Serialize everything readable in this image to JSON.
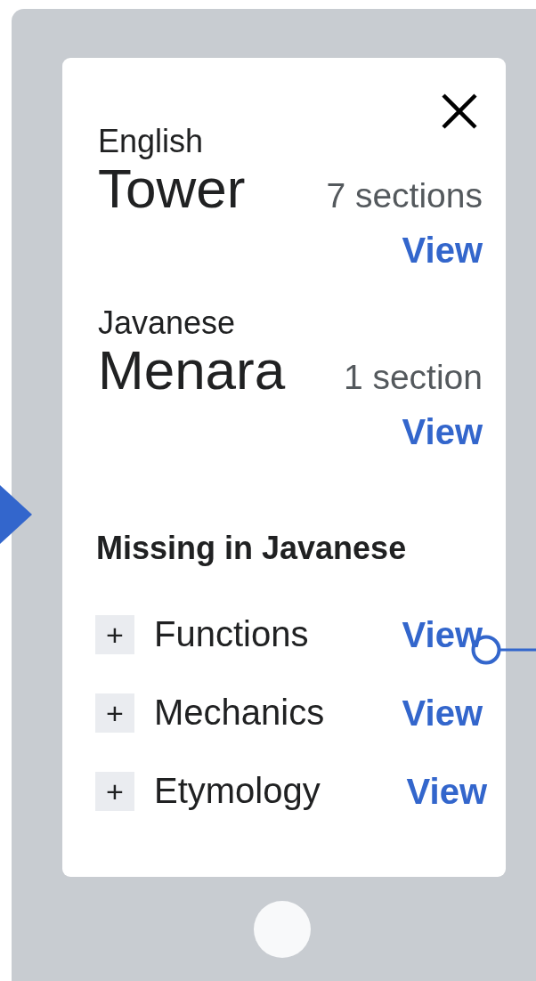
{
  "languages": [
    {
      "language": "English",
      "title": "Tower",
      "count": "7 sections",
      "action": "View"
    },
    {
      "language": "Javanese",
      "title": "Menara",
      "count": "1 section",
      "action": "View"
    }
  ],
  "missing": {
    "heading": "Missing in Javanese",
    "items": [
      {
        "expand": "+",
        "label": "Functions",
        "action": "View"
      },
      {
        "expand": "+",
        "label": "Mechanics",
        "action": "View"
      },
      {
        "expand": "+",
        "label": "Etymology",
        "action": "View"
      }
    ]
  }
}
